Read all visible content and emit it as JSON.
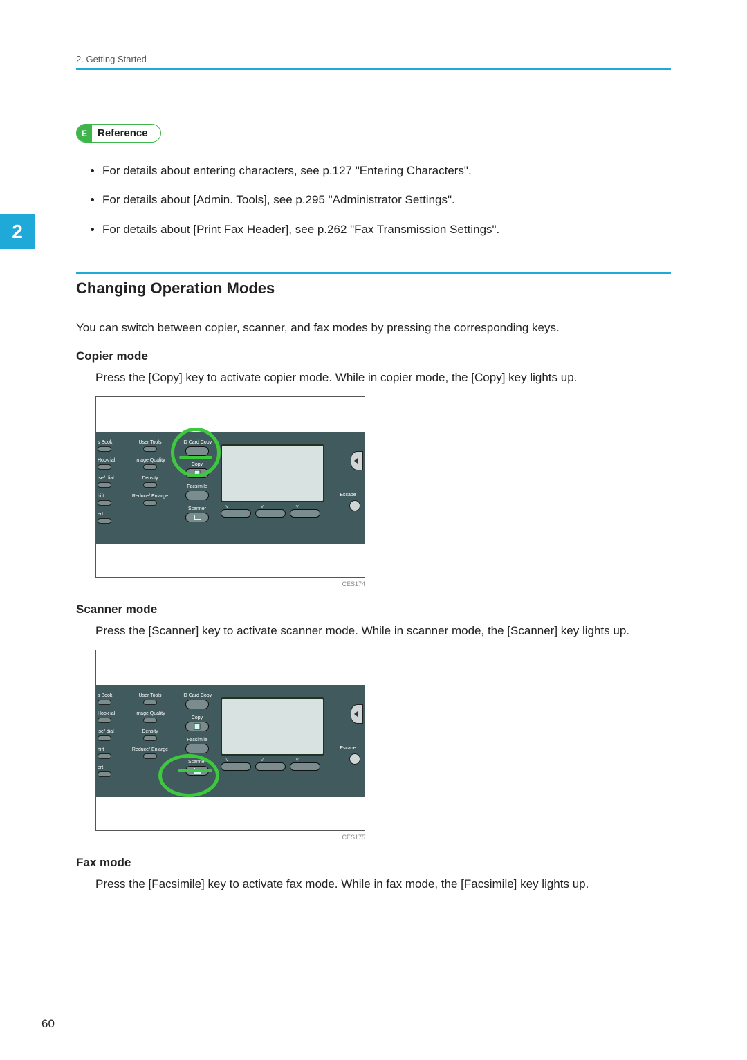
{
  "header": {
    "breadcrumb": "2. Getting Started"
  },
  "chapter": {
    "number": "2"
  },
  "reference": {
    "label": "Reference",
    "icon_glyph": "E",
    "items": [
      "For details about entering characters, see p.127 \"Entering Characters\".",
      "For details about [Admin. Tools], see p.295 \"Administrator Settings\".",
      "For details about [Print Fax Header], see p.262 \"Fax Transmission Settings\"."
    ]
  },
  "section": {
    "title": "Changing Operation Modes",
    "intro": "You can switch between copier, scanner, and fax modes by pressing the corresponding keys."
  },
  "modes": {
    "copier": {
      "heading": "Copier mode",
      "desc": "Press the [Copy] key to activate copier mode. While in copier mode, the [Copy] key lights up.",
      "caption": "CES174"
    },
    "scanner": {
      "heading": "Scanner mode",
      "desc": "Press the [Scanner] key to activate scanner mode. While in scanner mode, the [Scanner] key lights up.",
      "caption": "CES175"
    },
    "fax": {
      "heading": "Fax mode",
      "desc": "Press the [Facsimile] key to activate fax mode. While in fax mode, the [Facsimile] key lights up."
    }
  },
  "panel": {
    "left_labels": [
      "s Book",
      "Hook\nial",
      "ise/\ndial",
      "hift",
      "ert"
    ],
    "mid_labels": [
      "User Tools",
      "Image\nQuality",
      "Density",
      "Reduce/\nEnlarge"
    ],
    "mode_labels": {
      "idcard": "ID Card Copy",
      "copy": "Copy",
      "fax": "Facsimile",
      "scan": "Scanner"
    },
    "escape": "Escape"
  },
  "page_number": "60"
}
